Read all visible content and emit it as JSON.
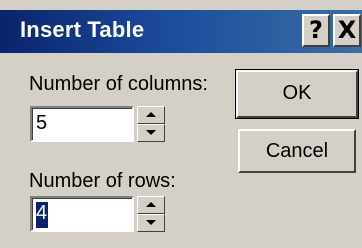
{
  "window": {
    "title": "Insert Table",
    "help_label": "?",
    "close_label": "X"
  },
  "form": {
    "columns_label": "Number of columns:",
    "columns_value": "5",
    "rows_label": "Number of rows:",
    "rows_value": "4",
    "rows_value_selected": true
  },
  "buttons": {
    "ok_label": "OK",
    "cancel_label": "Cancel"
  },
  "icons": {
    "help": "question-mark-icon",
    "close": "close-icon",
    "spin_up": "spin-up-arrow-icon",
    "spin_down": "spin-down-arrow-icon"
  },
  "colors": {
    "titlebar_start": "#0a246a",
    "titlebar_end": "#3a6ea5",
    "dialog_bg": "#d4d0c8",
    "selection": "#0a246a"
  }
}
